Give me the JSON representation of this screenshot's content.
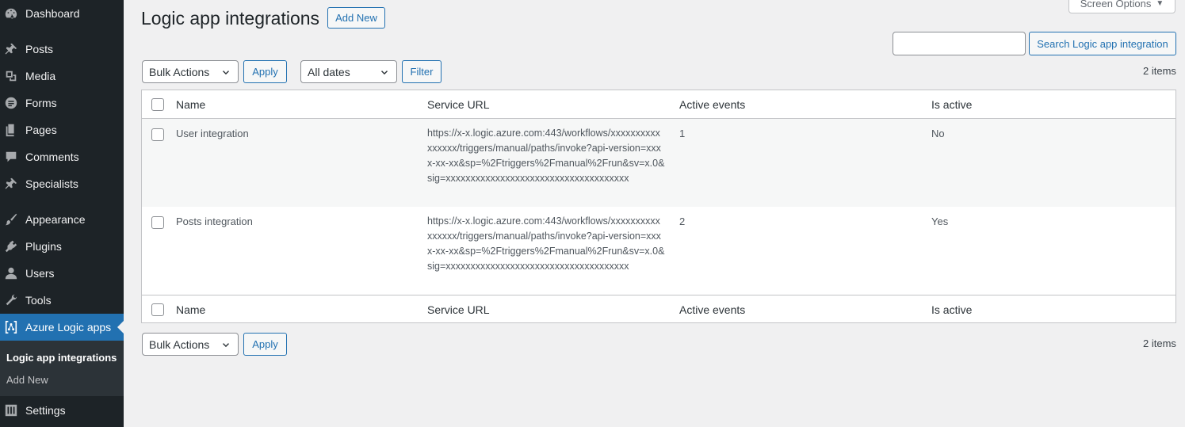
{
  "sidebar": {
    "items": [
      {
        "label": "Dashboard",
        "icon": "dashboard-icon"
      },
      {
        "label": "Posts",
        "icon": "pin-icon"
      },
      {
        "label": "Media",
        "icon": "media-icon"
      },
      {
        "label": "Forms",
        "icon": "forms-icon"
      },
      {
        "label": "Pages",
        "icon": "pages-icon"
      },
      {
        "label": "Comments",
        "icon": "comment-icon"
      },
      {
        "label": "Specialists",
        "icon": "pin-icon"
      },
      {
        "label": "Appearance",
        "icon": "brush-icon"
      },
      {
        "label": "Plugins",
        "icon": "plugin-icon"
      },
      {
        "label": "Users",
        "icon": "user-icon"
      },
      {
        "label": "Tools",
        "icon": "wrench-icon"
      },
      {
        "label": "Azure Logic apps",
        "icon": "logic-apps-icon"
      },
      {
        "label": "Settings",
        "icon": "settings-icon"
      }
    ],
    "submenu": [
      {
        "label": "Logic app integrations"
      },
      {
        "label": "Add New"
      }
    ]
  },
  "header": {
    "title": "Logic app integrations",
    "add_new": "Add New",
    "screen_options": "Screen Options"
  },
  "search": {
    "value": "",
    "button": "Search Logic app integration"
  },
  "top_nav": {
    "bulk_actions": "Bulk Actions",
    "apply": "Apply",
    "date_filter": "All dates",
    "filter": "Filter",
    "count": "2 items"
  },
  "bottom_nav": {
    "bulk_actions": "Bulk Actions",
    "apply": "Apply",
    "count": "2 items"
  },
  "table": {
    "columns": [
      "Name",
      "Service URL",
      "Active events",
      "Is active"
    ],
    "rows": [
      {
        "name": "User integration",
        "service_url": "https://x-x.logic.azure.com:443/workflows/xxxxxxxxxxxxxxxx/triggers/manual/paths/invoke?api-version=xxxx-xx-xx&sp=%2Ftriggers%2Fmanual%2Frun&sv=x.0&sig=xxxxxxxxxxxxxxxxxxxxxxxxxxxxxxxxxxxxx",
        "active_events": "1",
        "is_active": "No"
      },
      {
        "name": "Posts integration",
        "service_url": "https://x-x.logic.azure.com:443/workflows/xxxxxxxxxxxxxxxx/triggers/manual/paths/invoke?api-version=xxxx-xx-xx&sp=%2Ftriggers%2Fmanual%2Frun&sv=x.0&sig=xxxxxxxxxxxxxxxxxxxxxxxxxxxxxxxxxxxxx",
        "active_events": "2",
        "is_active": "Yes"
      }
    ]
  },
  "colors": {
    "sidebar_bg": "#1d2327",
    "accent": "#2271b1",
    "page_bg": "#f0f0f1"
  }
}
